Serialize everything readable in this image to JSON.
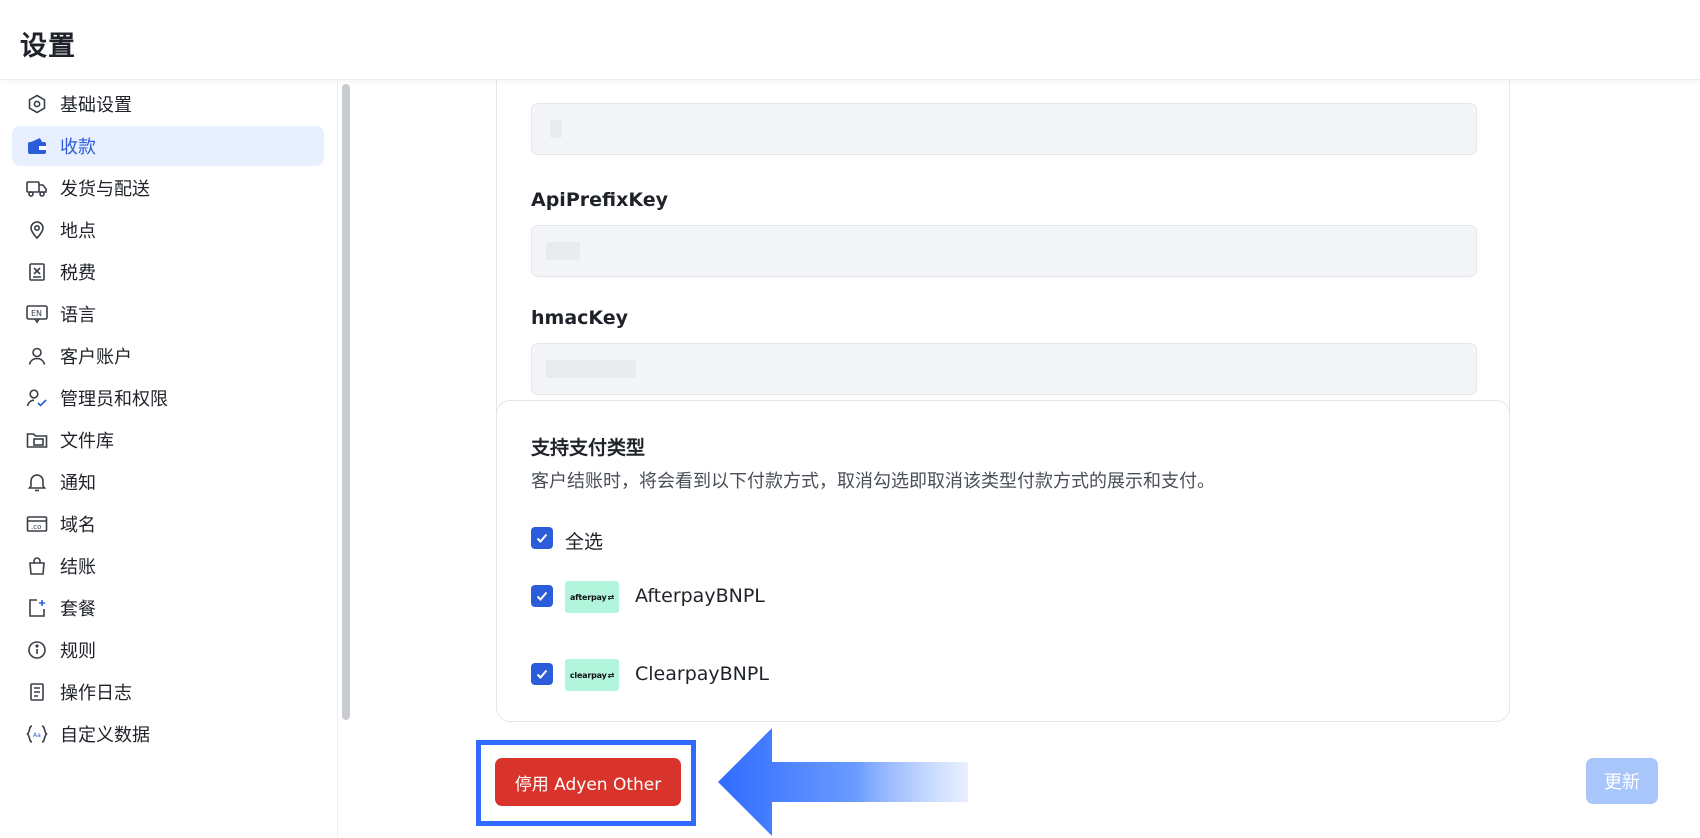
{
  "header": {
    "title": "设置"
  },
  "sidebar": {
    "items": [
      {
        "label": "基础设置",
        "icon": "hexagon-gear-icon",
        "active": false
      },
      {
        "label": "收款",
        "icon": "wallet-icon",
        "active": true
      },
      {
        "label": "发货与配送",
        "icon": "truck-icon",
        "active": false
      },
      {
        "label": "地点",
        "icon": "location-pin-icon",
        "active": false
      },
      {
        "label": "税费",
        "icon": "receipt-icon",
        "active": false
      },
      {
        "label": "语言",
        "icon": "language-en-icon",
        "active": false
      },
      {
        "label": "客户账户",
        "icon": "user-icon",
        "active": false
      },
      {
        "label": "管理员和权限",
        "icon": "user-check-icon",
        "active": false
      },
      {
        "label": "文件库",
        "icon": "folder-icon",
        "active": false
      },
      {
        "label": "通知",
        "icon": "bell-icon",
        "active": false
      },
      {
        "label": "域名",
        "icon": "domain-icon",
        "active": false
      },
      {
        "label": "结账",
        "icon": "shopping-bag-icon",
        "active": false
      },
      {
        "label": "套餐",
        "icon": "plan-plus-icon",
        "active": false
      },
      {
        "label": "规则",
        "icon": "info-icon",
        "active": false
      },
      {
        "label": "操作日志",
        "icon": "log-document-icon",
        "active": false
      },
      {
        "label": "自定义数据",
        "icon": "custom-data-braces-icon",
        "active": false
      }
    ]
  },
  "credentials": {
    "api_prefix_key_label": "ApiPrefixKey",
    "hmac_key_label": "hmacKey"
  },
  "payment_types": {
    "title": "支持支付类型",
    "description": "客户结账时，将会看到以下付款方式，取消勾选即取消该类型付款方式的展示和支付。",
    "select_all_label": "全选",
    "methods": [
      {
        "name": "AfterpayBNPL",
        "logo_text": "afterpay",
        "checked": true
      },
      {
        "name": "ClearpayBNPL",
        "logo_text": "clearpay",
        "checked": true
      }
    ]
  },
  "footer": {
    "disable_label": "停用 Adyen Other",
    "update_label": "更新"
  },
  "colors": {
    "accent": "#2b5cd9",
    "danger": "#d9342b",
    "highlight": "#2f6bff",
    "logo_mint": "#b2f5dc"
  }
}
